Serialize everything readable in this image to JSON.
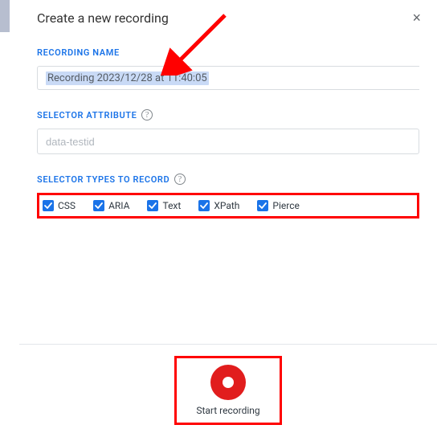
{
  "header": {
    "title": "Create a new recording",
    "close_label": "×"
  },
  "recording_name": {
    "label": "RECORDING NAME",
    "value": "Recording 2023/12/28 at 11:40:05"
  },
  "selector_attribute": {
    "label": "SELECTOR ATTRIBUTE",
    "placeholder": "data-testid",
    "value": "",
    "help": "?"
  },
  "selector_types": {
    "label": "SELECTOR TYPES TO RECORD",
    "help": "?",
    "options": [
      {
        "label": "CSS",
        "checked": true
      },
      {
        "label": "ARIA",
        "checked": true
      },
      {
        "label": "Text",
        "checked": true
      },
      {
        "label": "XPath",
        "checked": true
      },
      {
        "label": "Pierce",
        "checked": true
      }
    ]
  },
  "footer": {
    "start_label": "Start recording"
  },
  "annotations": {
    "arrow_color": "#ff0000",
    "highlight_color": "#ff0000"
  }
}
